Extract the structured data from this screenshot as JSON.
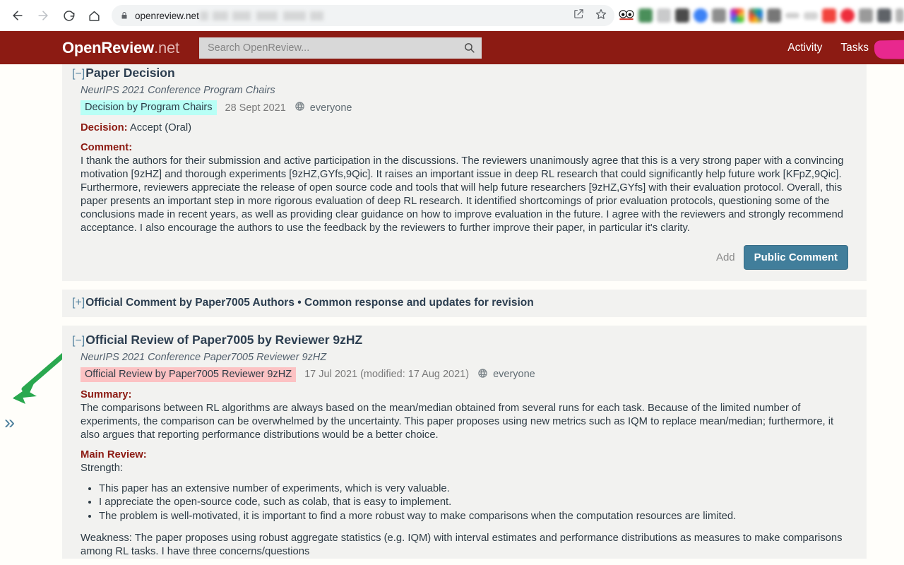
{
  "browser": {
    "back_icon": "back-arrow-icon",
    "forward_icon": "forward-arrow-icon",
    "reload_icon": "reload-icon",
    "home_icon": "home-icon",
    "lock_icon": "lock-icon",
    "url": "openreview.net",
    "share_icon": "share-icon",
    "bookmark_icon": "star-icon",
    "extensions_label": "extension-icons"
  },
  "header": {
    "brand_name": "OpenReview",
    "brand_tld": ".net",
    "search": {
      "placeholder": "Search OpenReview...",
      "value": "",
      "icon": "search-icon"
    },
    "nav": [
      {
        "label": "Activity"
      },
      {
        "label": "Tasks"
      }
    ],
    "user_menu_label": "",
    "bg_color": "#8c1b13"
  },
  "sidebar": {
    "expander_glyph": "»",
    "expander_name": "expand-sidebar-chevron"
  },
  "annotation": {
    "arrow_color": "#2aa84f",
    "points_to": "expand-sidebar-chevron"
  },
  "notes": [
    {
      "toggle": "[−]",
      "title": "Paper Decision",
      "authors": "NeurIPS 2021 Conference Program Chairs",
      "invitation_badge": "Decision by Program Chairs",
      "badge_color": "#b8fff6",
      "date": "28 Sept 2021",
      "readers_icon": "globe-icon",
      "readers": "everyone",
      "fields": [
        {
          "label": "Decision:",
          "value": "Accept (Oral)"
        },
        {
          "label": "Comment:",
          "value": "I thank the authors for their submission and active participation in the discussions. The reviewers unanimously agree that this is a very strong paper with a convincing motivation [9zHZ] and thorough experiments [9zHZ,GYfs,9Qic]. It raises an important issue in deep RL research that could significantly help future work [KFpZ,9Qic]. Furthermore, reviewers appreciate the release of open source code and tools that will help future researchers [9zHZ,GYfs] with their evaluation protocol. Overall, this paper presents an important step in more rigorous evaluation of deep RL research. It identified shortcomings of prior evaluation protocols, questioning some of the conclusions made in recent years, as well as providing clear guidance on how to improve evaluation in the future. I agree with the reviewers and strongly recommend acceptance. I also encourage the authors to use the feedback by the reviewers to further improve their paper, in particular it's clarity."
        }
      ],
      "actions": {
        "add_label": "Add",
        "button_label": "Public Comment"
      }
    }
  ],
  "collapsed_note": {
    "toggle": "[+]",
    "title": "Official Comment by Paper7005 Authors • Common response and updates for revision"
  },
  "review_note": {
    "toggle": "[−]",
    "title": "Official Review of Paper7005 by Reviewer 9zHZ",
    "authors": "NeurIPS 2021 Conference Paper7005 Reviewer 9zHZ",
    "invitation_badge": "Official Review by Paper7005 Reviewer 9zHZ",
    "badge_color": "#fcc2c3",
    "date": "17 Jul 2021 (modified: 17 Aug 2021)",
    "readers_icon": "globe-icon",
    "readers": "everyone",
    "summary_label": "Summary:",
    "summary_text": "The comparisons between RL algorithms are always based on the mean/median obtained from several runs for each task. Because of the limited number of experiments, the comparison can be overwhelmed by the uncertainty. This paper proposes using new metrics such as IQM to replace mean/median; furthermore, it also argues that reporting performance distributions would be a better choice.",
    "main_review_label": "Main Review:",
    "strength_label": "Strength:",
    "strength_bullets": [
      "This paper has an extensive number of experiments, which is very valuable.",
      "I appreciate the open-source code, such as colab, that is easy to implement.",
      "The problem is well-motivated, it is important to find a more robust way to make comparisons when the computation resources are limited."
    ],
    "weakness_text": "Weakness: The paper proposes using robust aggregate statistics (e.g. IQM) with interval estimates and performance distributions as measures to make comparisons among RL tasks. I have three concerns/questions"
  }
}
